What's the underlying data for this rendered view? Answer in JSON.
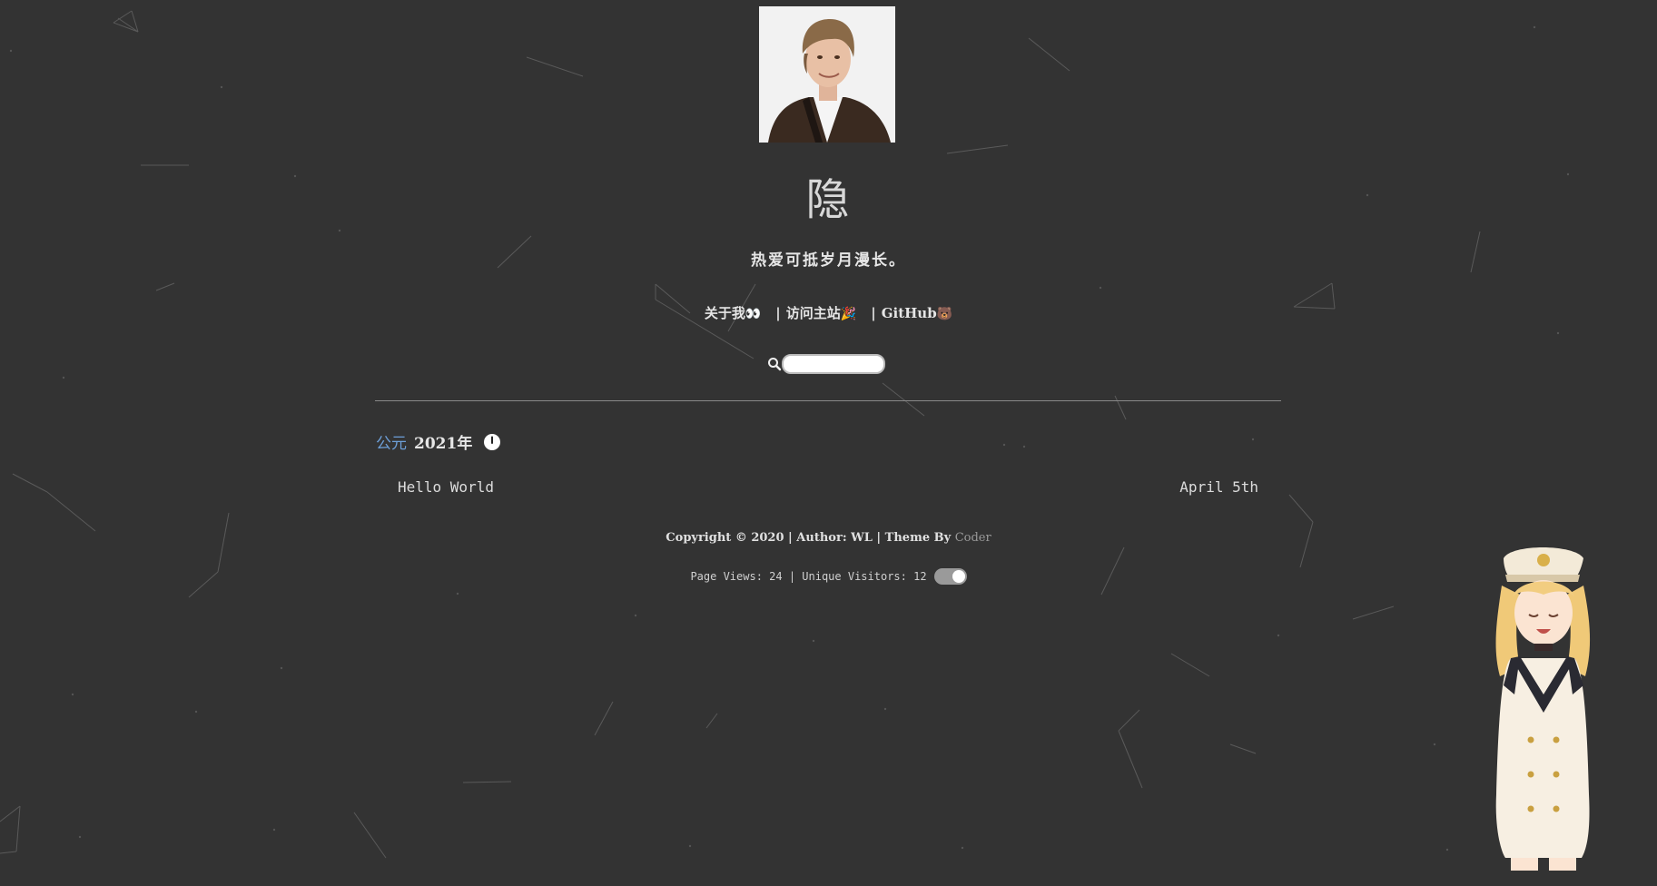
{
  "header": {
    "site_title": "隐",
    "subtitle": "热爱可抵岁月漫长。"
  },
  "nav": {
    "about": "关于我",
    "about_emoji": "👀",
    "main_site": "访问主站",
    "main_site_emoji": "🎉",
    "github": "GitHub",
    "github_emoji": "🐻",
    "separator": "|"
  },
  "search": {
    "value": "",
    "placeholder": ""
  },
  "archive": {
    "era_label": "公元",
    "year": "2021年",
    "posts": [
      {
        "title": "Hello World",
        "date": "April 5th"
      }
    ]
  },
  "footer": {
    "copyright_prefix": "Copyright © 2020 | Author: WL | Theme By ",
    "theme_link": "Coder",
    "stats": "Page Views: 24 | Unique Visitors: 12"
  },
  "colors": {
    "background": "#333333",
    "accent": "#6d9fd8",
    "text": "#dcdcdc"
  }
}
